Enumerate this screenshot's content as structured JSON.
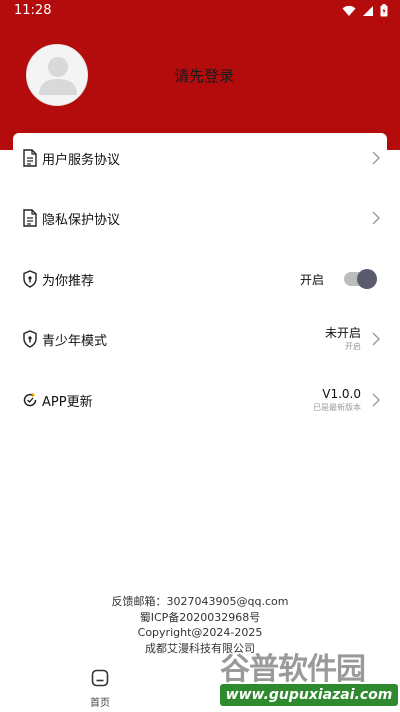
{
  "status_bar": {
    "time": "11:28"
  },
  "profile": {
    "login_prompt": "请先登录"
  },
  "menu": {
    "user_agreement": "用户服务协议",
    "privacy_policy": "隐私保护协议",
    "recommend": {
      "label": "为你推荐",
      "state_label": "开启",
      "enabled": true
    },
    "youth_mode": {
      "label": "青少年模式",
      "value": "未开启",
      "sub": "开启"
    },
    "app_update": {
      "label": "APP更新",
      "version": "V1.0.0",
      "sub": "已是最新版本"
    }
  },
  "footer": {
    "email": "反馈邮箱：3027043905@qq.com",
    "icp": "蜀ICP备2020032968号",
    "copyright": "Copyright@2024-2025",
    "company": "成都艾漫科技有限公司"
  },
  "bottom_nav": {
    "home_label": "首页"
  },
  "watermark": {
    "title": "谷普软件园",
    "url": "www.gupuxiazai.com"
  },
  "colors": {
    "header_red": "#b40c0c",
    "toggle_knob": "#5b5b6e"
  }
}
